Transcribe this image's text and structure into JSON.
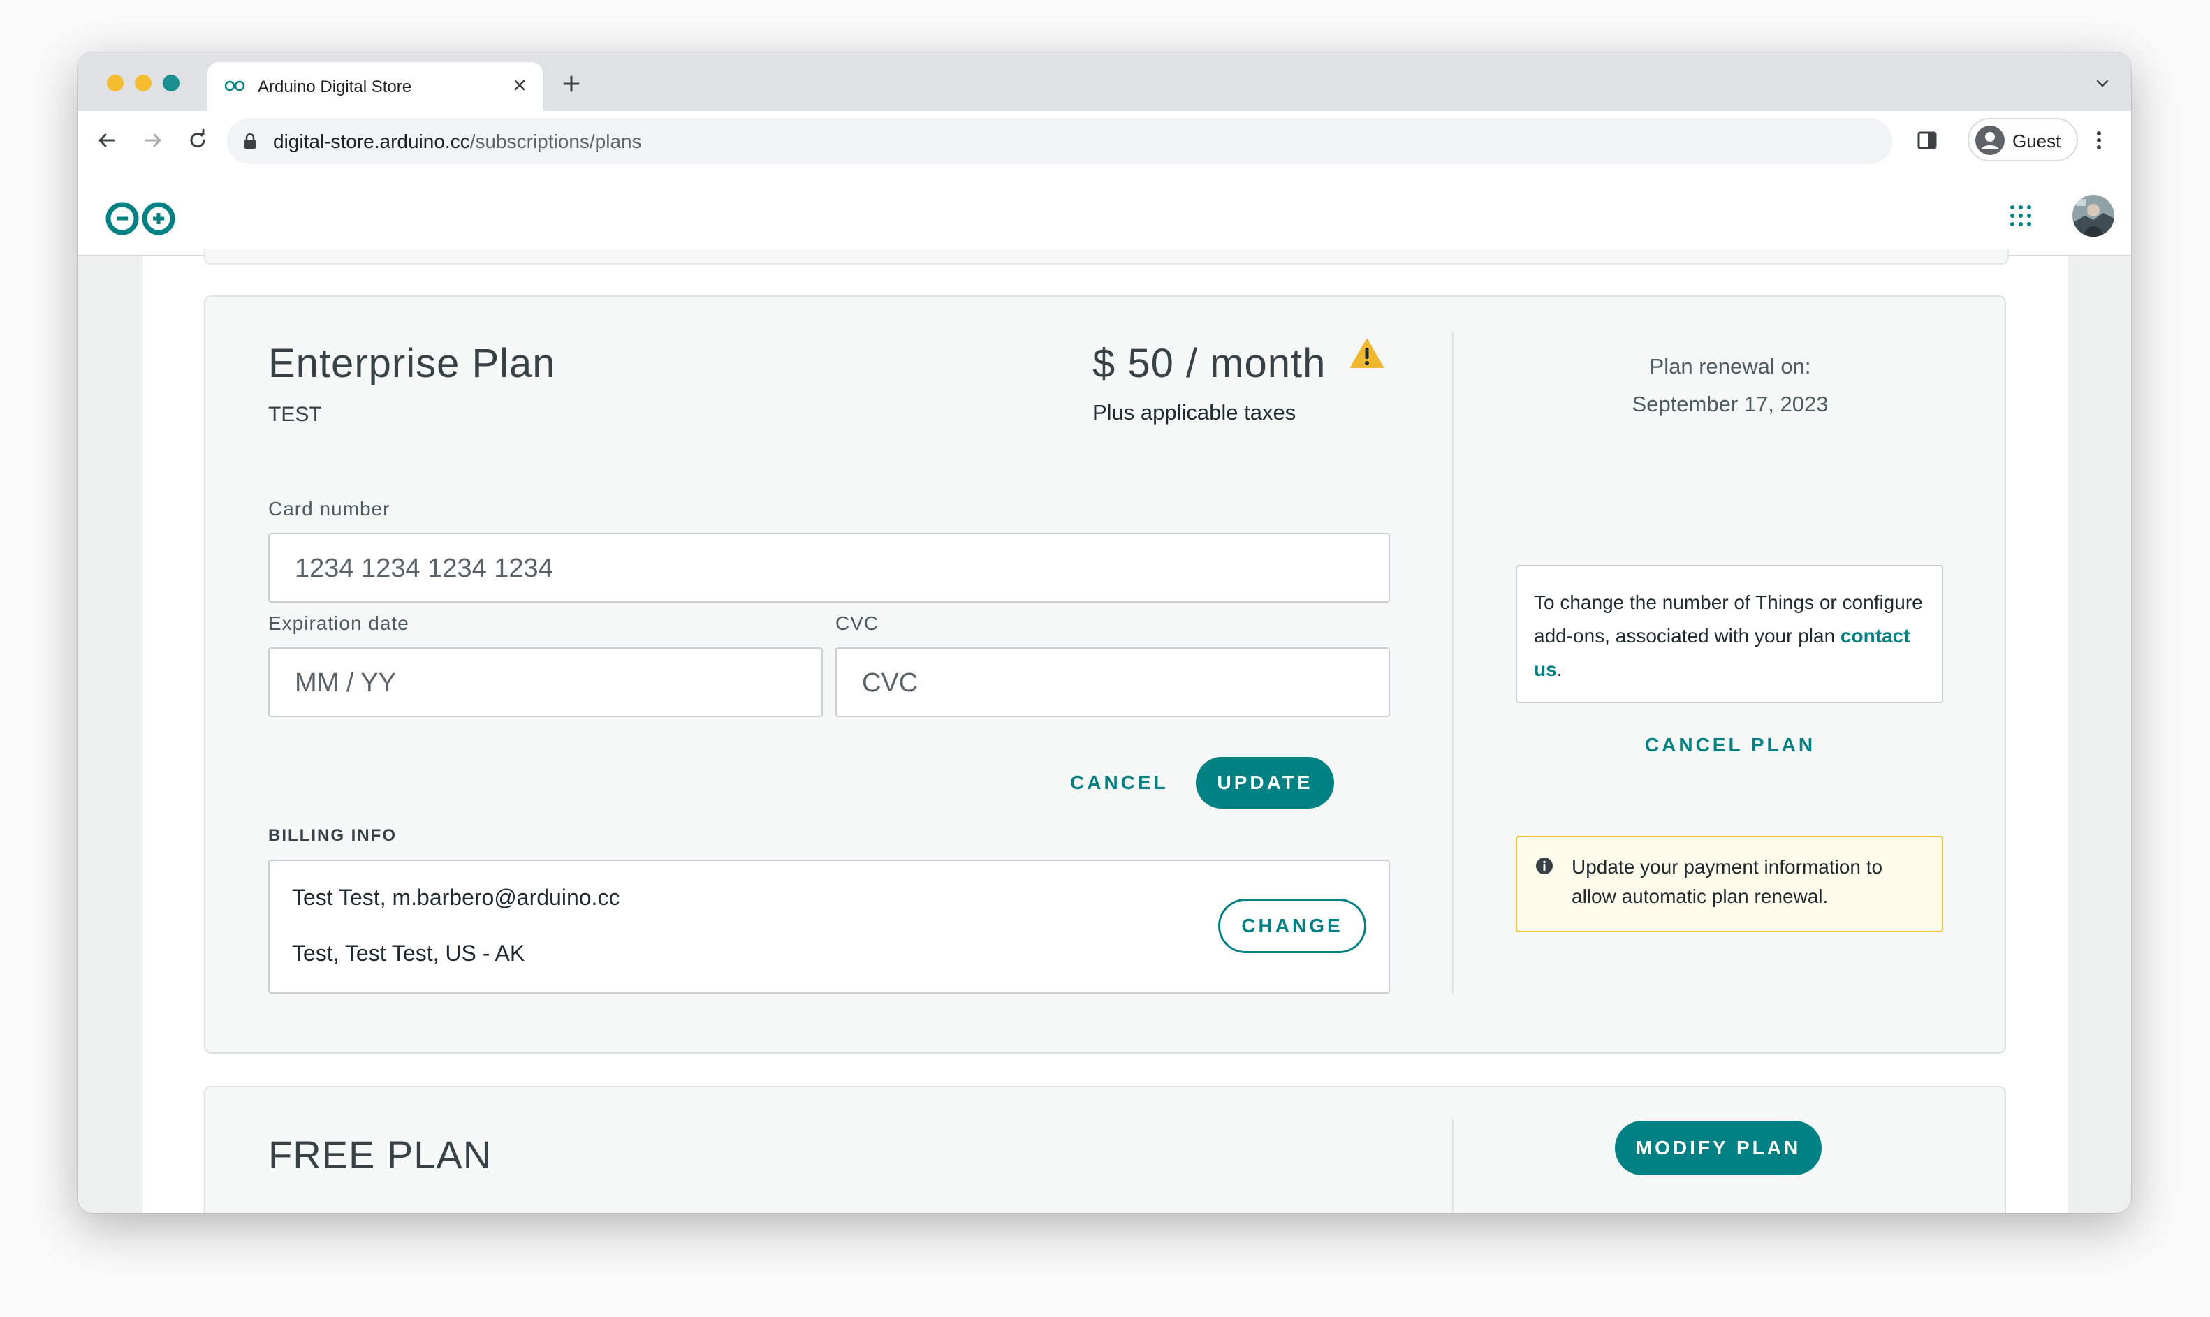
{
  "browser": {
    "tab_title": "Arduino Digital Store",
    "url_host": "digital-store.arduino.cc",
    "url_path": "/subscriptions/plans",
    "profile_label": "Guest"
  },
  "colors": {
    "accent": "#008184",
    "warning": "#f1c232",
    "text": "#374146"
  },
  "plan": {
    "name": "Enterprise Plan",
    "subtitle": "TEST",
    "price": "$ 50 / month",
    "taxes": "Plus applicable taxes",
    "warning_icon": "warning-triangle-icon"
  },
  "payment": {
    "card_number_label": "Card number",
    "card_number_placeholder": "1234 1234 1234 1234",
    "expiration_label": "Expiration date",
    "expiration_placeholder": "MM / YY",
    "cvc_label": "CVC",
    "cvc_placeholder": "CVC",
    "cancel_label": "CANCEL",
    "update_label": "UPDATE"
  },
  "billing": {
    "title": "BILLING INFO",
    "line1": "Test Test, m.barbero@arduino.cc",
    "line2": "Test, Test Test, US - AK",
    "change_label": "CHANGE"
  },
  "sidebar": {
    "renewal_label": "Plan renewal on:",
    "renewal_date": "September 17, 2023",
    "info_text": "To change the number of Things or configure add-ons, associated with your plan ",
    "info_link": "contact us",
    "info_end": ".",
    "cancel_plan_label": "CANCEL PLAN",
    "notice_text": "Update your payment information to allow automatic plan renewal."
  },
  "free_plan": {
    "title": "FREE PLAN",
    "modify_label": "MODIFY PLAN"
  }
}
